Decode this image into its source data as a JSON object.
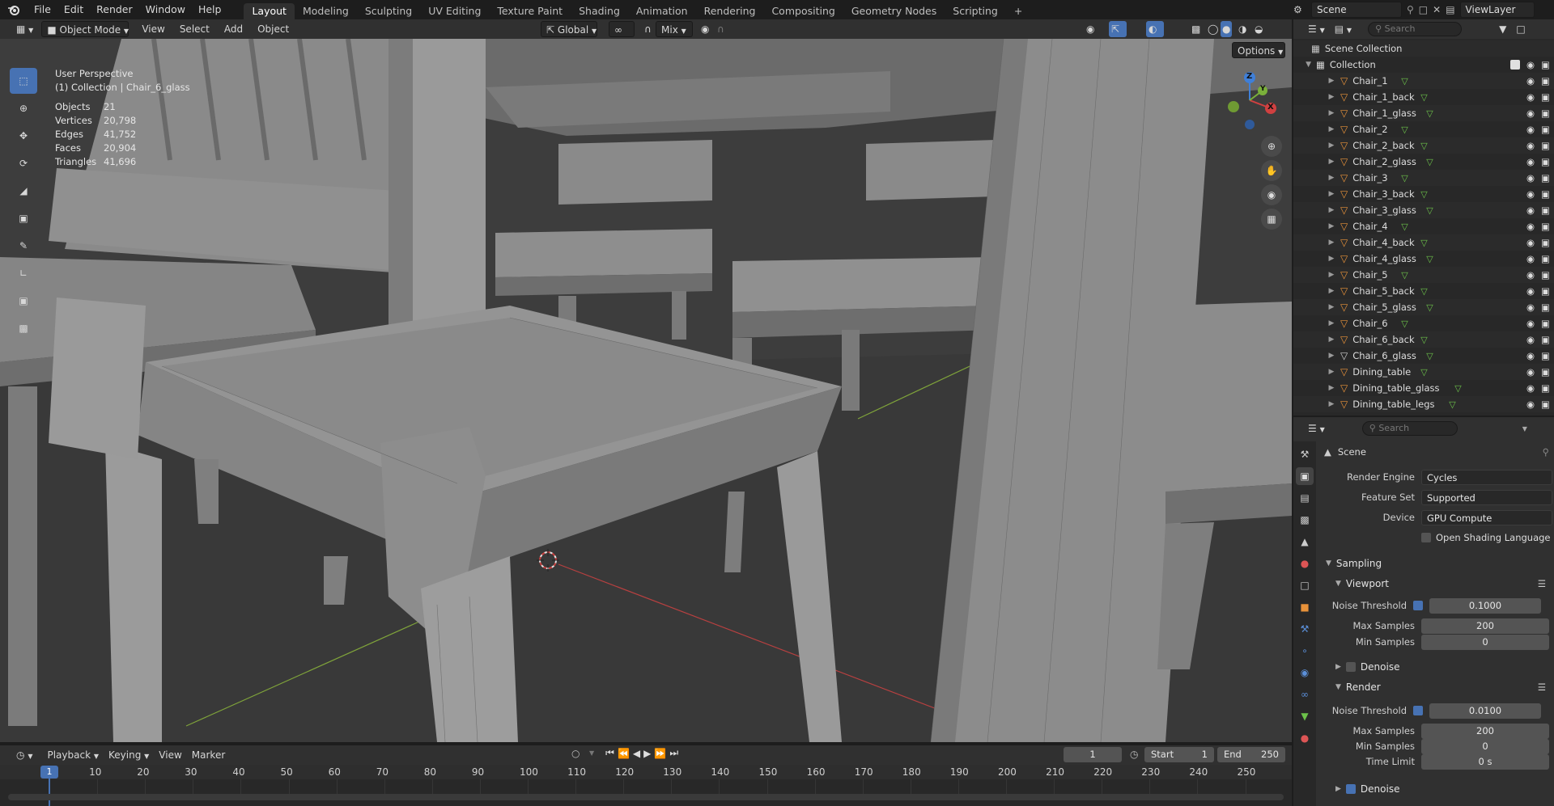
{
  "menu": {
    "file": "File",
    "edit": "Edit",
    "render": "Render",
    "window": "Window",
    "help": "Help"
  },
  "workspaces": [
    "Layout",
    "Modeling",
    "Sculpting",
    "UV Editing",
    "Texture Paint",
    "Shading",
    "Animation",
    "Rendering",
    "Compositing",
    "Geometry Nodes",
    "Scripting"
  ],
  "workspace_add": "+",
  "scene_selector": "Scene",
  "viewlayer_selector": "ViewLayer",
  "viewport_header": {
    "mode": "Object Mode",
    "view": "View",
    "select": "Select",
    "add": "Add",
    "object": "Object",
    "transform_orientation": "Global",
    "snap_mode": "Mix",
    "options": "Options"
  },
  "viewport_overlay": {
    "perspective": "User Perspective",
    "collection_line": "(1) Collection | Chair_6_glass",
    "stats": [
      {
        "label": "Objects",
        "value": "21"
      },
      {
        "label": "Vertices",
        "value": "20,798"
      },
      {
        "label": "Edges",
        "value": "41,752"
      },
      {
        "label": "Faces",
        "value": "20,904"
      },
      {
        "label": "Triangles",
        "value": "41,696"
      }
    ]
  },
  "gizmo": {
    "x": "X",
    "y": "Y",
    "z": "Z"
  },
  "timeline_header": {
    "playback": "Playback",
    "keying": "Keying",
    "view": "View",
    "marker": "Marker",
    "current_frame": "1",
    "start_label": "Start",
    "start_value": "1",
    "end_label": "End",
    "end_value": "250"
  },
  "timeline": {
    "current": "1",
    "ticks": [
      "10",
      "20",
      "30",
      "40",
      "50",
      "60",
      "70",
      "80",
      "90",
      "100",
      "110",
      "120",
      "130",
      "140",
      "150",
      "160",
      "170",
      "180",
      "190",
      "200",
      "210",
      "220",
      "230",
      "240",
      "250"
    ]
  },
  "outliner": {
    "search_placeholder": "Search",
    "scene_collection": "Scene Collection",
    "collection": "Collection",
    "objects": [
      "Chair_1",
      "Chair_1_back",
      "Chair_1_glass",
      "Chair_2",
      "Chair_2_back",
      "Chair_2_glass",
      "Chair_3",
      "Chair_3_back",
      "Chair_3_glass",
      "Chair_4",
      "Chair_4_back",
      "Chair_4_glass",
      "Chair_5",
      "Chair_5_back",
      "Chair_5_glass",
      "Chair_6",
      "Chair_6_back",
      "Chair_6_glass",
      "Dining_table",
      "Dining_table_glass",
      "Dining_table_legs"
    ],
    "active_object": "Chair_6_glass"
  },
  "properties": {
    "search_placeholder": "Search",
    "context": "Scene",
    "render_engine_label": "Render Engine",
    "render_engine": "Cycles",
    "feature_set_label": "Feature Set",
    "feature_set": "Supported",
    "device_label": "Device",
    "device": "GPU Compute",
    "osl_label": "Open Shading Language",
    "sampling": "Sampling",
    "viewport": "Viewport",
    "vp_noise_threshold_label": "Noise Threshold",
    "vp_noise_threshold": "0.1000",
    "vp_max_samples_label": "Max Samples",
    "vp_max_samples": "200",
    "vp_min_samples_label": "Min Samples",
    "vp_min_samples": "0",
    "vp_denoise": "Denoise",
    "render": "Render",
    "r_noise_threshold_label": "Noise Threshold",
    "r_noise_threshold": "0.0100",
    "r_max_samples_label": "Max Samples",
    "r_max_samples": "200",
    "r_min_samples_label": "Min Samples",
    "r_min_samples": "0",
    "r_time_limit_label": "Time Limit",
    "r_time_limit": "0 s",
    "r_denoise": "Denoise"
  },
  "colors": {
    "accent": "#4772b3",
    "object_orange": "#e8923a",
    "mesh_green": "#6cc24a",
    "axis_red": "#c8413f",
    "axis_green": "#7fa33a"
  }
}
